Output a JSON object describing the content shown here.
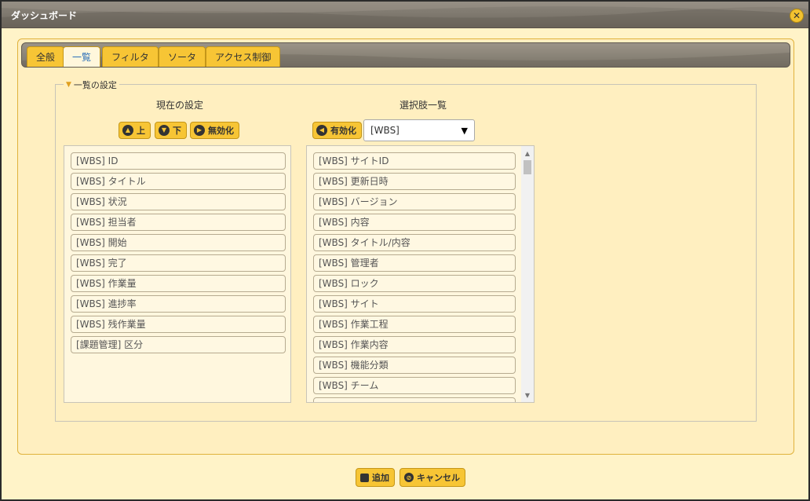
{
  "dialog": {
    "title": "ダッシュボード"
  },
  "tabs": [
    {
      "label": "全般"
    },
    {
      "label": "一覧"
    },
    {
      "label": "フィルタ"
    },
    {
      "label": "ソータ"
    },
    {
      "label": "アクセス制御"
    }
  ],
  "fieldset": {
    "legend": "一覧の設定"
  },
  "current": {
    "title": "現在の設定",
    "up_label": "上",
    "down_label": "下",
    "disable_label": "無効化",
    "items": [
      "[WBS] ID",
      "[WBS] タイトル",
      "[WBS] 状況",
      "[WBS] 担当者",
      "[WBS] 開始",
      "[WBS] 完了",
      "[WBS] 作業量",
      "[WBS] 進捗率",
      "[WBS] 残作業量",
      "[課題管理] 区分"
    ]
  },
  "options": {
    "title": "選択肢一覧",
    "enable_label": "有効化",
    "select_value": "[WBS]",
    "items": [
      "[WBS] サイトID",
      "[WBS] 更新日時",
      "[WBS] バージョン",
      "[WBS] 内容",
      "[WBS] タイトル/内容",
      "[WBS] 管理者",
      "[WBS] ロック",
      "[WBS] サイト",
      "[WBS] 作業工程",
      "[WBS] 作業内容",
      "[WBS] 機能分類",
      "[WBS] チーム"
    ]
  },
  "footer": {
    "add_label": "追加",
    "cancel_label": "キャンセル"
  },
  "colors": {
    "accent": "#f7c535",
    "panel": "#ffefc0",
    "active_tab_text": "#2a6fb8"
  }
}
